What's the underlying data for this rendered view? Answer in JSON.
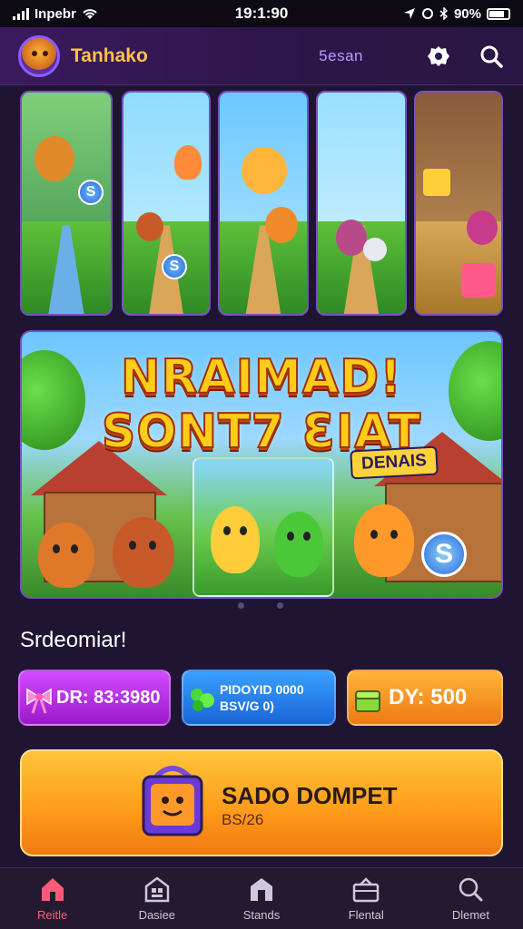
{
  "status_bar": {
    "carrier": "Inpebr",
    "time": "19:1:90",
    "battery": "90%"
  },
  "header": {
    "app_name": "Tanhako",
    "season_label": "5esan",
    "avatar_icon": "avatar-character",
    "settings_icon": "gear-icon",
    "search_icon": "search-icon"
  },
  "game_cards": [
    {
      "name": "card-1",
      "sky": "#7fcf7a",
      "accent": "#e08a2a"
    },
    {
      "name": "card-2",
      "sky": "#8fdcff",
      "accent": "#ff8a3a"
    },
    {
      "name": "card-3",
      "sky": "#6cc8ff",
      "accent": "#ffb43a"
    },
    {
      "name": "card-4",
      "sky": "#9adfff",
      "accent": "#b84a8a"
    },
    {
      "name": "card-5",
      "sky": "#8a5a3a",
      "accent": "#ffcf3a"
    }
  ],
  "banner": {
    "title_line1": "NRAIMAD!",
    "title_line2": "SONT7 ƐIAT",
    "badge": "DENAIS"
  },
  "section": {
    "title": "Srdeomiar!"
  },
  "rewards": [
    {
      "label": "DR: 83:3980",
      "icon": "bow-icon",
      "color": "#c83aff"
    },
    {
      "label_line1": "PIDOYID 0000",
      "label_line2": "BSV/G 0)",
      "icon": "gem-icon",
      "color": "#2a84f0"
    },
    {
      "label": "DY: 500",
      "icon": "chest-icon",
      "color": "#ff9a1a"
    }
  ],
  "cta": {
    "title": "SADO DOMPET",
    "subtitle": "BS/26",
    "icon": "wallet-character-icon"
  },
  "tabs": [
    {
      "label": "Reitle",
      "icon": "home-icon",
      "active": true
    },
    {
      "label": "Dasiee",
      "icon": "building-icon",
      "active": false
    },
    {
      "label": "Stands",
      "icon": "store-icon",
      "active": false
    },
    {
      "label": "Flental",
      "icon": "case-icon",
      "active": false
    },
    {
      "label": "Dlemet",
      "icon": "search-icon",
      "active": false
    }
  ],
  "colors": {
    "background": "#1f1533",
    "header": "#2c1648",
    "brand_text": "#ffc24a",
    "season_text": "#b89cff",
    "active_tab": "#ff5a7a"
  }
}
